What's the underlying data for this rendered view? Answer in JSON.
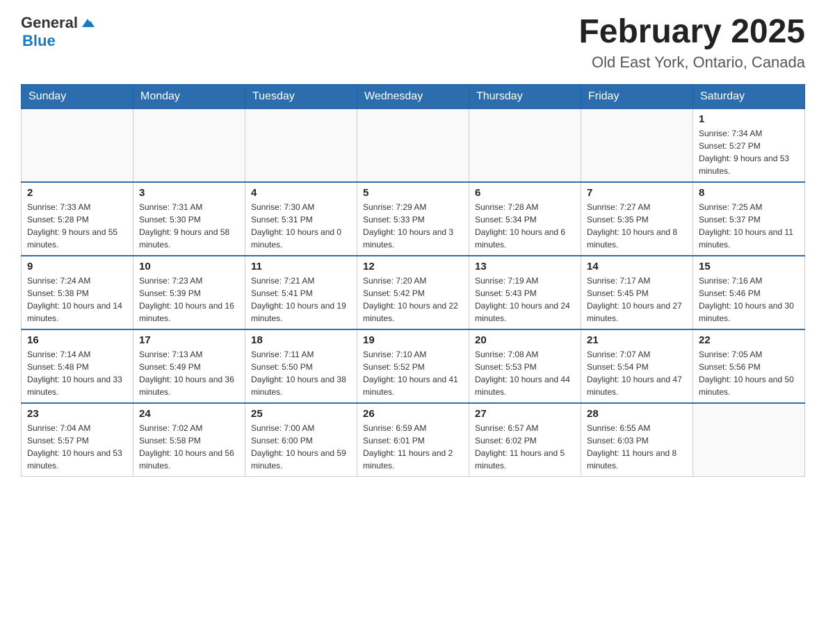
{
  "header": {
    "logo_general": "General",
    "logo_blue": "Blue",
    "month_title": "February 2025",
    "location": "Old East York, Ontario, Canada"
  },
  "days_of_week": [
    "Sunday",
    "Monday",
    "Tuesday",
    "Wednesday",
    "Thursday",
    "Friday",
    "Saturday"
  ],
  "weeks": [
    [
      {
        "num": "",
        "info": ""
      },
      {
        "num": "",
        "info": ""
      },
      {
        "num": "",
        "info": ""
      },
      {
        "num": "",
        "info": ""
      },
      {
        "num": "",
        "info": ""
      },
      {
        "num": "",
        "info": ""
      },
      {
        "num": "1",
        "info": "Sunrise: 7:34 AM\nSunset: 5:27 PM\nDaylight: 9 hours and 53 minutes."
      }
    ],
    [
      {
        "num": "2",
        "info": "Sunrise: 7:33 AM\nSunset: 5:28 PM\nDaylight: 9 hours and 55 minutes."
      },
      {
        "num": "3",
        "info": "Sunrise: 7:31 AM\nSunset: 5:30 PM\nDaylight: 9 hours and 58 minutes."
      },
      {
        "num": "4",
        "info": "Sunrise: 7:30 AM\nSunset: 5:31 PM\nDaylight: 10 hours and 0 minutes."
      },
      {
        "num": "5",
        "info": "Sunrise: 7:29 AM\nSunset: 5:33 PM\nDaylight: 10 hours and 3 minutes."
      },
      {
        "num": "6",
        "info": "Sunrise: 7:28 AM\nSunset: 5:34 PM\nDaylight: 10 hours and 6 minutes."
      },
      {
        "num": "7",
        "info": "Sunrise: 7:27 AM\nSunset: 5:35 PM\nDaylight: 10 hours and 8 minutes."
      },
      {
        "num": "8",
        "info": "Sunrise: 7:25 AM\nSunset: 5:37 PM\nDaylight: 10 hours and 11 minutes."
      }
    ],
    [
      {
        "num": "9",
        "info": "Sunrise: 7:24 AM\nSunset: 5:38 PM\nDaylight: 10 hours and 14 minutes."
      },
      {
        "num": "10",
        "info": "Sunrise: 7:23 AM\nSunset: 5:39 PM\nDaylight: 10 hours and 16 minutes."
      },
      {
        "num": "11",
        "info": "Sunrise: 7:21 AM\nSunset: 5:41 PM\nDaylight: 10 hours and 19 minutes."
      },
      {
        "num": "12",
        "info": "Sunrise: 7:20 AM\nSunset: 5:42 PM\nDaylight: 10 hours and 22 minutes."
      },
      {
        "num": "13",
        "info": "Sunrise: 7:19 AM\nSunset: 5:43 PM\nDaylight: 10 hours and 24 minutes."
      },
      {
        "num": "14",
        "info": "Sunrise: 7:17 AM\nSunset: 5:45 PM\nDaylight: 10 hours and 27 minutes."
      },
      {
        "num": "15",
        "info": "Sunrise: 7:16 AM\nSunset: 5:46 PM\nDaylight: 10 hours and 30 minutes."
      }
    ],
    [
      {
        "num": "16",
        "info": "Sunrise: 7:14 AM\nSunset: 5:48 PM\nDaylight: 10 hours and 33 minutes."
      },
      {
        "num": "17",
        "info": "Sunrise: 7:13 AM\nSunset: 5:49 PM\nDaylight: 10 hours and 36 minutes."
      },
      {
        "num": "18",
        "info": "Sunrise: 7:11 AM\nSunset: 5:50 PM\nDaylight: 10 hours and 38 minutes."
      },
      {
        "num": "19",
        "info": "Sunrise: 7:10 AM\nSunset: 5:52 PM\nDaylight: 10 hours and 41 minutes."
      },
      {
        "num": "20",
        "info": "Sunrise: 7:08 AM\nSunset: 5:53 PM\nDaylight: 10 hours and 44 minutes."
      },
      {
        "num": "21",
        "info": "Sunrise: 7:07 AM\nSunset: 5:54 PM\nDaylight: 10 hours and 47 minutes."
      },
      {
        "num": "22",
        "info": "Sunrise: 7:05 AM\nSunset: 5:56 PM\nDaylight: 10 hours and 50 minutes."
      }
    ],
    [
      {
        "num": "23",
        "info": "Sunrise: 7:04 AM\nSunset: 5:57 PM\nDaylight: 10 hours and 53 minutes."
      },
      {
        "num": "24",
        "info": "Sunrise: 7:02 AM\nSunset: 5:58 PM\nDaylight: 10 hours and 56 minutes."
      },
      {
        "num": "25",
        "info": "Sunrise: 7:00 AM\nSunset: 6:00 PM\nDaylight: 10 hours and 59 minutes."
      },
      {
        "num": "26",
        "info": "Sunrise: 6:59 AM\nSunset: 6:01 PM\nDaylight: 11 hours and 2 minutes."
      },
      {
        "num": "27",
        "info": "Sunrise: 6:57 AM\nSunset: 6:02 PM\nDaylight: 11 hours and 5 minutes."
      },
      {
        "num": "28",
        "info": "Sunrise: 6:55 AM\nSunset: 6:03 PM\nDaylight: 11 hours and 8 minutes."
      },
      {
        "num": "",
        "info": ""
      }
    ]
  ]
}
